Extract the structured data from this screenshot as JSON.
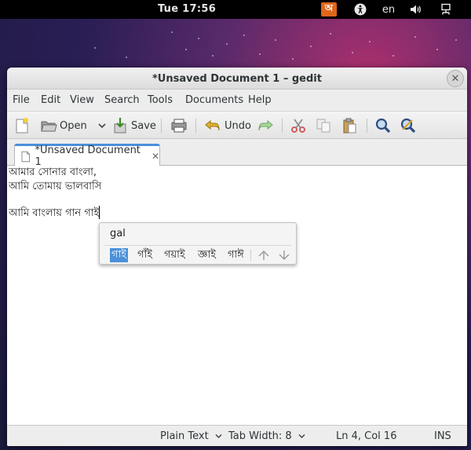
{
  "topbar": {
    "clock": "Tue 17:56",
    "ime_indicator": "অ",
    "language": "en"
  },
  "window": {
    "title": "*Unsaved Document 1 – gedit",
    "close_glyph": "✕"
  },
  "menubar": {
    "items": [
      "File",
      "Edit",
      "View",
      "Search",
      "Tools",
      "Documents",
      "Help"
    ]
  },
  "toolbar": {
    "open_label": "Open",
    "save_label": "Save",
    "undo_label": "Undo"
  },
  "tab": {
    "label": "*Unsaved Document 1",
    "close_glyph": "✕"
  },
  "editor": {
    "lines": [
      "আমার সোনার বাংলা,",
      "আমি তোমায় ভালবাসি",
      "",
      "আমি বাংলায় গান গাই"
    ]
  },
  "ime_popup": {
    "preedit": "gal",
    "candidates": [
      "গাই",
      "গাঁই",
      "গয়াই",
      "জ্ঞাই",
      "গাঈ"
    ],
    "selected_index": 0
  },
  "statusbar": {
    "syntax": "Plain Text",
    "tab_width": "Tab Width:  8",
    "position": "Ln 4, Col 16",
    "mode": "INS"
  },
  "colors": {
    "accent": "#4a90d9",
    "topbar": "#000000",
    "ime_indicator": "#e0661a"
  }
}
